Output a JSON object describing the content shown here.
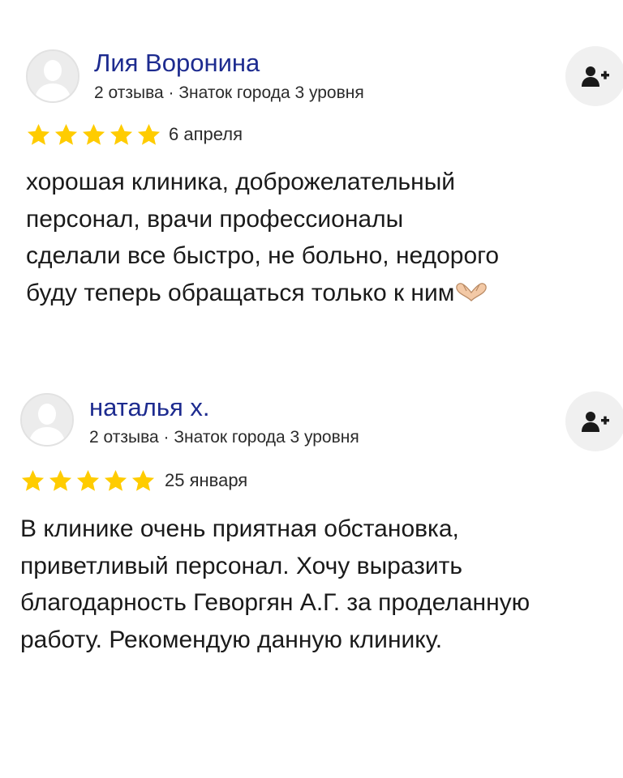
{
  "reviews": [
    {
      "author": "Лия Воронина",
      "meta": "2 отзыва · Знаток города 3 уровня",
      "rating": 5,
      "date": "6 апреля",
      "text": "хорошая клиника, доброжелательный\nперсонал, врачи профессионалы\nсделали все быстро, не больно, недорого\nбуду теперь обращаться только к ним",
      "text_emoji": "heart-hands-emoji"
    },
    {
      "author": "наталья х.",
      "meta": "2 отзыва · Знаток города 3 уровня",
      "rating": 5,
      "date": "25 января",
      "text": "В клинике очень приятная обстановка,\nприветливый персонал. Хочу выразить\nблагодарность Геворгян А.Г. за проделанную\nработу. Рекомендую данную клинику."
    }
  ],
  "icons": {
    "follow": "add-user-icon",
    "star": "star-icon",
    "avatar": "user-silhouette-icon"
  },
  "colors": {
    "author_name": "#1d2b8f",
    "star": "#ffcc00",
    "follow_bg": "#f0f0f0"
  }
}
